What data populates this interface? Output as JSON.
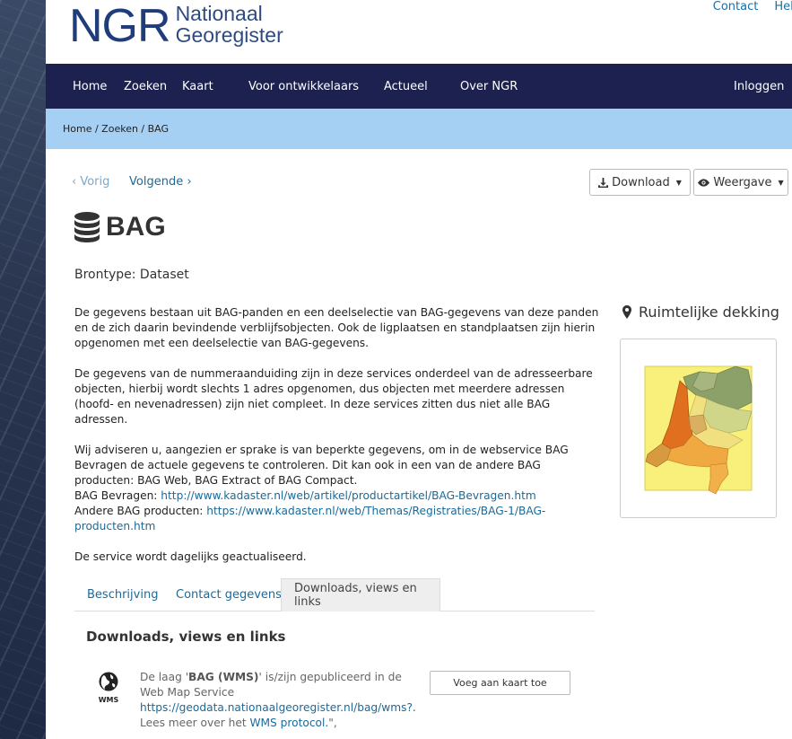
{
  "logo": {
    "abbr": "NGR",
    "line1": "Nationaal",
    "line2": "Georegister"
  },
  "top_links": [
    "Contact",
    "Help"
  ],
  "nav": {
    "items": [
      "Home",
      "Zoeken",
      "Kaart",
      "Voor ontwikkelaars",
      "Actueel",
      "Over NGR"
    ],
    "login": "Inloggen"
  },
  "breadcrumb": "Home / Zoeken / BAG",
  "pager": {
    "prev": "Vorig",
    "next": "Volgende"
  },
  "buttons": {
    "download": "Download",
    "view": "Weergave"
  },
  "dataset": {
    "title": "BAG",
    "brontype": "Brontype: Dataset",
    "para1": "De gegevens bestaan uit BAG-panden en een deelselectie van BAG-gegevens van deze panden en de zich daarin bevindende verblijfsobjecten. Ook de ligplaatsen en standplaatsen zijn hierin opgenomen met een deelselectie van BAG-gegevens.",
    "para2": "De gegevens van de nummeraanduiding zijn in deze services onderdeel van de adresseerbare objecten, hierbij wordt slechts 1 adres opgenomen, dus objecten met meerdere adressen (hoofd- en nevenadressen) zijn niet compleet. In deze services zitten dus niet alle BAG adressen.",
    "para3": "Wij adviseren u, aangezien er sprake is van beperkte gegevens, om in de webservice BAG Bevragen de actuele gegevens te controleren. Dit kan ook in een van de andere BAG producten: BAG Web, BAG Extract of BAG Compact.",
    "bevragen_label": "BAG Bevragen: ",
    "bevragen_url": "http://www.kadaster.nl/web/artikel/productartikel/BAG-Bevragen.htm",
    "andere_label": "Andere BAG producten: ",
    "andere_url": "https://www.kadaster.nl/web/Themas/Registraties/BAG-1/BAG-producten.htm",
    "para4": "De service wordt dagelijks geactualiseerd."
  },
  "spatial": {
    "title": "Ruimtelijke dekking"
  },
  "tabs": [
    "Beschrijving",
    "Contact gegevens",
    "Downloads, views en links"
  ],
  "downloads": {
    "heading": "Downloads, views en links",
    "wms_label": "WMS",
    "text_prefix": "De laag '",
    "layer_name": "BAG (WMS)",
    "text_suffix": "' is/zijn gepubliceerd in de Web Map Service",
    "url": "https://geodata.nationaalgeoregister.nl/bag/wms?.",
    "more_prefix": "Lees meer over het ",
    "more_link": "WMS protocol.",
    "more_suffix": "\",",
    "add_button": "Voeg aan kaart toe"
  },
  "colors": {
    "nav_bg": "#1c2150",
    "crumb_bg": "#a6d0f3",
    "link": "#1a6a9a"
  }
}
